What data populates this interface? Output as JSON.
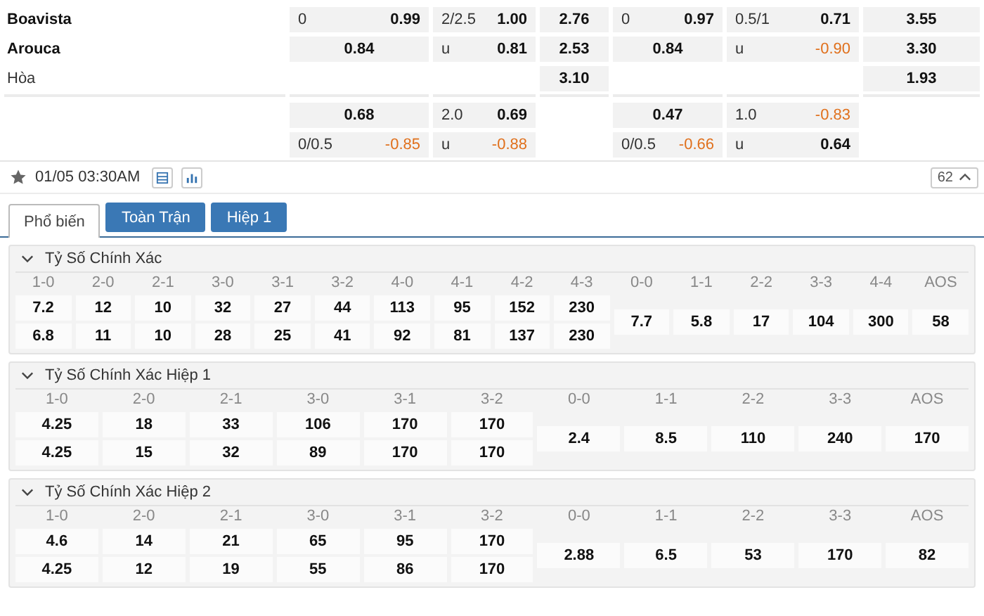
{
  "match": {
    "rows": [
      {
        "team": "Boavista",
        "bold": true,
        "cells": [
          {
            "label": "0",
            "value": "0.99",
            "negative": false
          },
          {
            "label": "2/2.5",
            "value": "1.00",
            "negative": false
          },
          {
            "value": "2.76",
            "negative": false
          },
          {
            "label": "0",
            "value": "0.97",
            "negative": false
          },
          {
            "label": "0.5/1",
            "value": "0.71",
            "negative": false
          },
          {
            "value": "3.55",
            "negative": false
          }
        ]
      },
      {
        "team": "Arouca",
        "bold": true,
        "cells": [
          {
            "value": "0.84",
            "negative": false
          },
          {
            "label": "u",
            "value": "0.81",
            "negative": false
          },
          {
            "value": "2.53",
            "negative": false
          },
          {
            "value": "0.84",
            "negative": false
          },
          {
            "label": "u",
            "value": "-0.90",
            "negative": true
          },
          {
            "value": "3.30",
            "negative": false
          }
        ]
      },
      {
        "team": "Hòa",
        "bold": false,
        "cells": [
          null,
          null,
          {
            "value": "3.10",
            "negative": false
          },
          null,
          null,
          {
            "value": "1.93",
            "negative": false
          }
        ]
      },
      {
        "cells": [
          {
            "value": "0.68",
            "negative": false
          },
          {
            "label": "2.0",
            "value": "0.69",
            "negative": false
          },
          null,
          {
            "value": "0.47",
            "negative": false
          },
          {
            "label": "1.0",
            "value": "-0.83",
            "negative": true
          },
          null
        ]
      },
      {
        "cells": [
          {
            "label": "0/0.5",
            "value": "-0.85",
            "negative": true
          },
          {
            "label": "u",
            "value": "-0.88",
            "negative": true
          },
          null,
          {
            "label": "0/0.5",
            "value": "-0.66",
            "negative": true
          },
          {
            "label": "u",
            "value": "0.64",
            "negative": false
          },
          null
        ]
      }
    ]
  },
  "toolbar": {
    "datetime": "01/05 03:30AM",
    "count": "62"
  },
  "tabs": [
    {
      "label": "Phổ biến",
      "selected": true
    },
    {
      "label": "Toàn Trận",
      "selected": false
    },
    {
      "label": "Hiệp 1",
      "selected": false
    }
  ],
  "sections": [
    {
      "title": "Tỷ Số Chính Xác",
      "home_away": [
        {
          "label": "1-0",
          "home": "7.2",
          "away": "6.8"
        },
        {
          "label": "2-0",
          "home": "12",
          "away": "11"
        },
        {
          "label": "2-1",
          "home": "10",
          "away": "10"
        },
        {
          "label": "3-0",
          "home": "32",
          "away": "28"
        },
        {
          "label": "3-1",
          "home": "27",
          "away": "25"
        },
        {
          "label": "3-2",
          "home": "44",
          "away": "41"
        },
        {
          "label": "4-0",
          "home": "113",
          "away": "92"
        },
        {
          "label": "4-1",
          "home": "95",
          "away": "81"
        },
        {
          "label": "4-2",
          "home": "152",
          "away": "137"
        },
        {
          "label": "4-3",
          "home": "230",
          "away": "230"
        }
      ],
      "draw": [
        {
          "label": "0-0",
          "value": "7.7"
        },
        {
          "label": "1-1",
          "value": "5.8"
        },
        {
          "label": "2-2",
          "value": "17"
        },
        {
          "label": "3-3",
          "value": "104"
        },
        {
          "label": "4-4",
          "value": "300"
        },
        {
          "label": "AOS",
          "value": "58"
        }
      ]
    },
    {
      "title": "Tỷ Số Chính Xác Hiệp 1",
      "home_away": [
        {
          "label": "1-0",
          "home": "4.25",
          "away": "4.25"
        },
        {
          "label": "2-0",
          "home": "18",
          "away": "15"
        },
        {
          "label": "2-1",
          "home": "33",
          "away": "32"
        },
        {
          "label": "3-0",
          "home": "106",
          "away": "89"
        },
        {
          "label": "3-1",
          "home": "170",
          "away": "170"
        },
        {
          "label": "3-2",
          "home": "170",
          "away": "170"
        }
      ],
      "draw": [
        {
          "label": "0-0",
          "value": "2.4"
        },
        {
          "label": "1-1",
          "value": "8.5"
        },
        {
          "label": "2-2",
          "value": "110"
        },
        {
          "label": "3-3",
          "value": "240"
        },
        {
          "label": "AOS",
          "value": "170"
        }
      ]
    },
    {
      "title": "Tỷ Số Chính Xác Hiệp 2",
      "home_away": [
        {
          "label": "1-0",
          "home": "4.6",
          "away": "4.25"
        },
        {
          "label": "2-0",
          "home": "14",
          "away": "12"
        },
        {
          "label": "2-1",
          "home": "21",
          "away": "19"
        },
        {
          "label": "3-0",
          "home": "65",
          "away": "55"
        },
        {
          "label": "3-1",
          "home": "95",
          "away": "86"
        },
        {
          "label": "3-2",
          "home": "170",
          "away": "170"
        }
      ],
      "draw": [
        {
          "label": "0-0",
          "value": "2.88"
        },
        {
          "label": "1-1",
          "value": "6.5"
        },
        {
          "label": "2-2",
          "value": "53"
        },
        {
          "label": "3-3",
          "value": "170"
        },
        {
          "label": "AOS",
          "value": "82"
        }
      ]
    }
  ]
}
